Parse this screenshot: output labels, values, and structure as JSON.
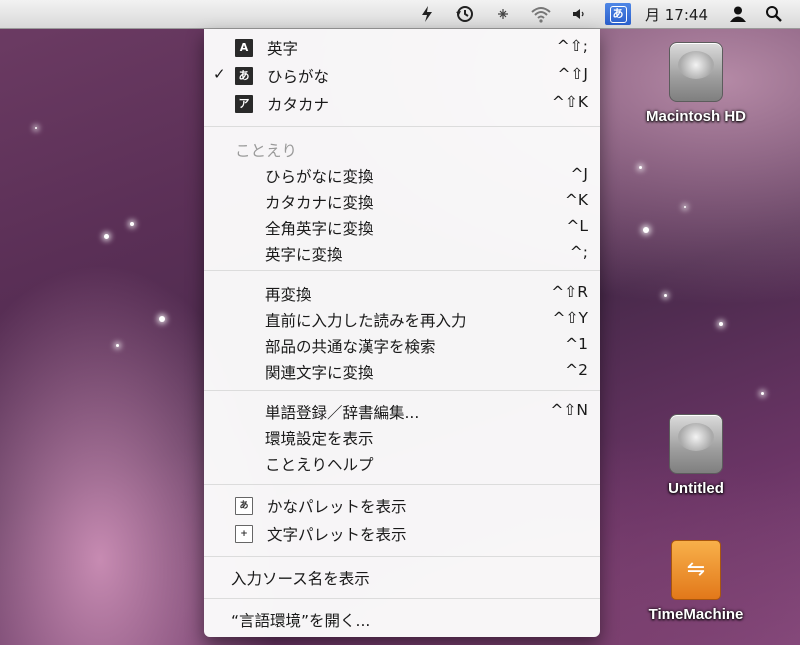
{
  "menubar": {
    "clock": "月 17:44",
    "icons": [
      "scripts-icon",
      "time-machine-icon",
      "bluetooth-icon",
      "wifi-icon",
      "volume-icon"
    ],
    "input_method_glyph": "あ"
  },
  "menu": {
    "modes": [
      {
        "icon": "A",
        "label": "英字",
        "shortcut": "^⇧;",
        "checked": false
      },
      {
        "icon": "あ",
        "label": "ひらがな",
        "shortcut": "^⇧J",
        "checked": true
      },
      {
        "icon": "ア",
        "label": "カタカナ",
        "shortcut": "^⇧K",
        "checked": false
      }
    ],
    "check_mark": "✓",
    "section_title": "ことえり",
    "convert_items": [
      {
        "label": "ひらがなに変換",
        "shortcut": "^J"
      },
      {
        "label": "カタカナに変換",
        "shortcut": "^K"
      },
      {
        "label": "全角英字に変換",
        "shortcut": "^L"
      },
      {
        "label": "英字に変換",
        "shortcut": "^;"
      }
    ],
    "reconvert_items": [
      {
        "label": "再変換",
        "shortcut": "^⇧R"
      },
      {
        "label": "直前に入力した読みを再入力",
        "shortcut": "^⇧Y"
      },
      {
        "label": "部品の共通な漢字を検索",
        "shortcut": "^1"
      },
      {
        "label": "関連文字に変換",
        "shortcut": "^2"
      }
    ],
    "tool_items": [
      {
        "label": "単語登録／辞書編集...",
        "shortcut": "^⇧N"
      },
      {
        "label": "環境設定を表示",
        "shortcut": ""
      },
      {
        "label": "ことえりヘルプ",
        "shortcut": ""
      }
    ],
    "palette_items": [
      {
        "icon": "あ",
        "label": "かなパレットを表示"
      },
      {
        "icon": "+",
        "label": "文字パレットを表示"
      }
    ],
    "show_source_name": "入力ソース名を表示",
    "open_prefs": "“言語環境”を開く..."
  },
  "desktop": {
    "icons": [
      {
        "name": "Macintosh HD",
        "kind": "drive"
      },
      {
        "name": "Untitled",
        "kind": "drive"
      },
      {
        "name": "TimeMachine",
        "kind": "usb"
      }
    ]
  }
}
